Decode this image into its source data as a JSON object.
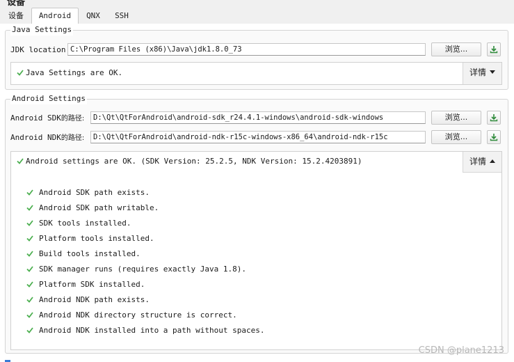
{
  "window": {
    "title": "设备"
  },
  "tabs": [
    {
      "label": "设备",
      "active": false
    },
    {
      "label": "Android",
      "active": true
    },
    {
      "label": "QNX",
      "active": false
    },
    {
      "label": "SSH",
      "active": false
    }
  ],
  "java": {
    "group_title": "Java Settings",
    "jdk_label": "JDK location:",
    "jdk_value": "C:\\Program Files (x86)\\Java\\jdk1.8.0_73",
    "browse_label": "浏览...",
    "status": "Java Settings are OK.",
    "details_label": "详情"
  },
  "android": {
    "group_title": "Android Settings",
    "sdk_label_prefix": "Android SDK",
    "sdk_label_suffix": "的路径:",
    "sdk_value": "D:\\Qt\\QtForAndroid\\android-sdk_r24.4.1-windows\\android-sdk-windows",
    "ndk_label_prefix": "Android NDK",
    "ndk_label_suffix": "的路径:",
    "ndk_value": "D:\\Qt\\QtForAndroid\\android-ndk-r15c-windows-x86_64\\android-ndk-r15c",
    "browse_label": "浏览...",
    "status": "Android settings are OK. (SDK Version: 25.2.5, NDK Version: 15.2.4203891)",
    "details_label": "详情",
    "checks": [
      "Android SDK path exists.",
      "Android SDK path writable.",
      "SDK tools installed.",
      "Platform tools installed.",
      "Build tools installed.",
      "SDK manager runs (requires exactly Java 1.8).",
      "Platform SDK installed.",
      "Android NDK path exists.",
      "Android NDK directory structure is correct.",
      "Android NDK installed into a path without spaces."
    ]
  },
  "watermark": "CSDN @plane1213",
  "colors": {
    "check_green": "#4caf50",
    "download_green": "#2e8b3a",
    "accent_blue": "#3a7bd5"
  },
  "icons": {
    "check": "check-icon",
    "download": "download-icon",
    "details_collapsed": "chevron-down-icon",
    "details_expanded": "chevron-up-icon"
  }
}
